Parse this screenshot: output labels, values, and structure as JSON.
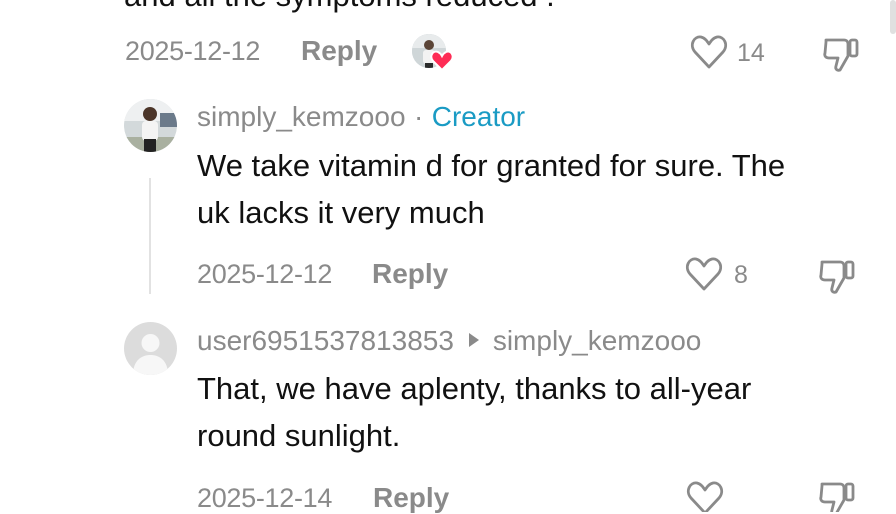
{
  "top_comment": {
    "partial_text": "and all the symptoms reduced .",
    "date": "2025-12-12",
    "reply_label": "Reply",
    "likes": "14"
  },
  "reply1": {
    "username": "simply_kemzooo",
    "separator": "·",
    "badge": "Creator",
    "text_line1": "We take vitamin d for granted for sure. The",
    "text_line2": "uk lacks it very much",
    "date": "2025-12-12",
    "reply_label": "Reply",
    "likes": "8"
  },
  "reply2": {
    "username": "user6951537813853",
    "reply_to": "simply_kemzooo",
    "text_line1": "That, we have aplenty, thanks to all-year",
    "text_line2": "round sunlight.",
    "date": "2025-12-14",
    "reply_label": "Reply"
  },
  "icons": {
    "like": "heart-outline-icon",
    "dislike": "thumbs-down-icon",
    "liked_by_creator": "creator-heart-badge-icon",
    "reply_arrow": "play-arrow-icon"
  },
  "colors": {
    "creator": "#1a9bc4",
    "muted": "#8a8a8a",
    "heart_badge": "#fe2c55"
  }
}
